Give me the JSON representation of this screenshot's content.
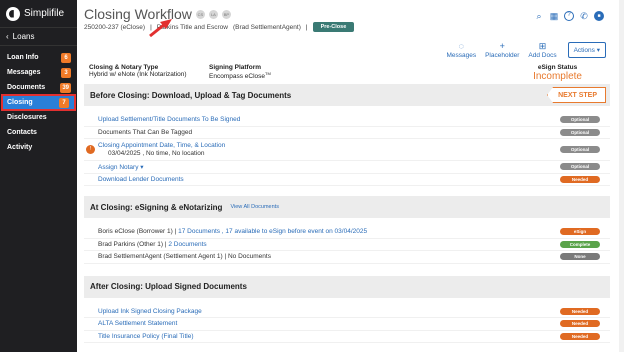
{
  "sidebar": {
    "logo": "Simplifile",
    "back_label": "Loans",
    "items": [
      {
        "label": "Loan Info",
        "count": "6"
      },
      {
        "label": "Messages",
        "count": "3"
      },
      {
        "label": "Documents",
        "count": "39"
      },
      {
        "label": "Closing",
        "count": "7"
      },
      {
        "label": "Disclosures",
        "count": ""
      },
      {
        "label": "Contacts",
        "count": ""
      },
      {
        "label": "Activity",
        "count": ""
      }
    ]
  },
  "header": {
    "title": "Closing Workflow",
    "avatars": [
      "CS",
      "LA",
      "BP"
    ],
    "loan_id": "250200-237 (eClose)",
    "separator": "|",
    "company": "Parkins Title and Escrow",
    "agent": "(Brad SettlementAgent)",
    "status_button": "Pre-Close",
    "actions": [
      {
        "label": "Messages",
        "icon": "chat-icon"
      },
      {
        "label": "Placeholder",
        "icon": "plus-icon"
      },
      {
        "label": "Add Docs",
        "icon": "add-docs-icon"
      }
    ],
    "actions_button": "Actions",
    "info": {
      "type_label": "Closing & Notary Type",
      "type_value": "Hybrid w/ eNote (Ink Notarization)",
      "platform_label": "Signing Platform",
      "platform_value": "Encompass eClose",
      "platform_tm": "TM",
      "esign_label": "eSign Status",
      "esign_value": "Incomplete"
    }
  },
  "sections": {
    "before": {
      "title": "Before Closing: Download, Upload & Tag Documents",
      "next_step": "NEXT STEP",
      "rows": [
        {
          "text": "Upload Settlement/Title Documents To Be Signed",
          "status": "Optional"
        },
        {
          "text": "Documents That Can Be Tagged",
          "status": "Optional"
        },
        {
          "text": "Closing Appointment Date, Time, & Location",
          "sub": "03/04/2025 , No time, No location",
          "status": "Optional"
        },
        {
          "text": "Assign Notary",
          "status": "Optional"
        },
        {
          "text": "Download Lender Documents",
          "status": "Needed"
        }
      ]
    },
    "at": {
      "title": "At Closing: eSigning & eNotarizing",
      "link": "View All Documents",
      "rows": [
        {
          "name": "Boris eClose (Borrower 1)",
          "docs": "17 Documents , 17 available to eSign before event on 03/04/2025",
          "status": "eSign"
        },
        {
          "name": "Brad Parkins (Other 1)",
          "docs": "2 Documents",
          "status": "Complete"
        },
        {
          "name": "Brad SettlementAgent (Settlement Agent 1)",
          "docs": "No Documents",
          "status": "None"
        }
      ]
    },
    "after": {
      "title": "After Closing: Upload Signed Documents",
      "rows": [
        {
          "text": "Upload Ink Signed Closing Package",
          "status": "Needed"
        },
        {
          "text": "ALTA Settlement Statement",
          "status": "Needed"
        },
        {
          "text": "Title Insurance Policy (Final Title)",
          "status": "Needed"
        }
      ]
    }
  },
  "colors": {
    "accent": "#2a6cb8",
    "sidebar_bg": "#1f1f22",
    "needed": "#e06a22",
    "complete": "#5aa34a",
    "optional": "#8b8b8b",
    "annotation": "#e23030"
  }
}
